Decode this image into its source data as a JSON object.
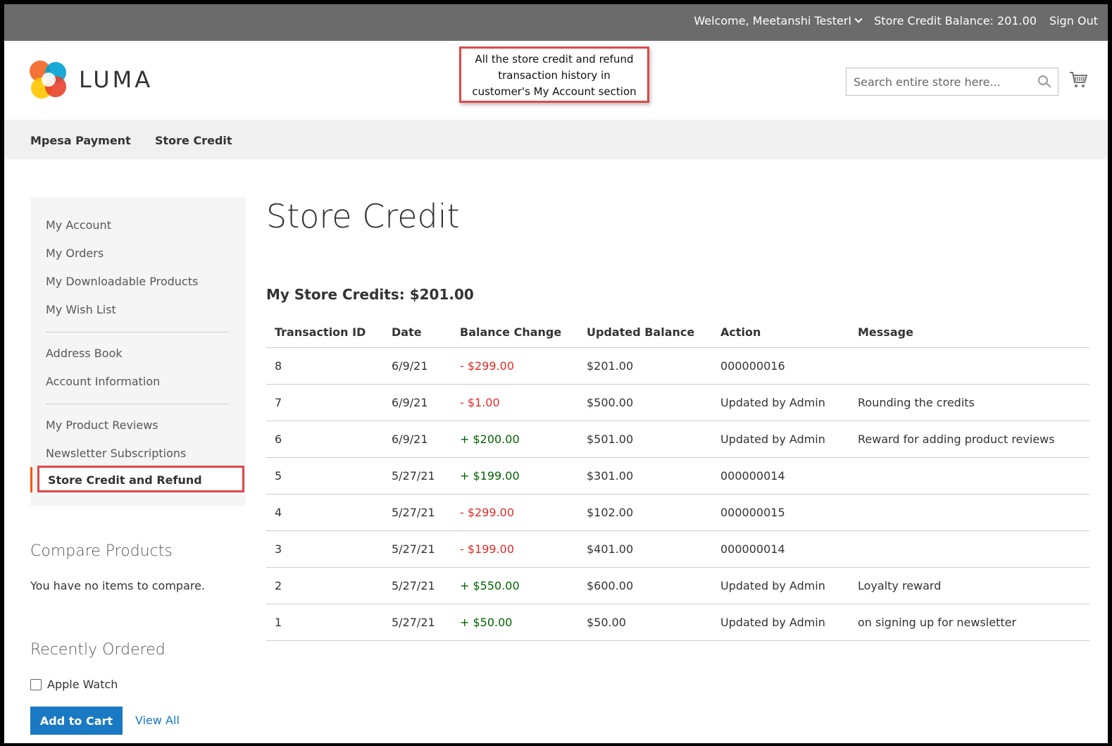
{
  "topbar": {
    "welcome": "Welcome, Meetanshi TesterI",
    "balance": "Store Credit Balance: 201.00",
    "sign_out": "Sign Out"
  },
  "header": {
    "logo_text": "LUMA",
    "search_placeholder": "Search entire store here...",
    "callout_lines": [
      "All the store credit and refund",
      "transaction history in",
      "customer's My Account section"
    ]
  },
  "nav": {
    "items": [
      "Mpesa Payment",
      "Store Credit"
    ]
  },
  "sidebar": {
    "items": [
      "My Account",
      "My Orders",
      "My Downloadable Products",
      "My Wish List",
      "Address Book",
      "Account Information",
      "My Product Reviews",
      "Newsletter Subscriptions"
    ],
    "active": "Store Credit and Refund"
  },
  "compare": {
    "title": "Compare Products",
    "empty": "You have no items to compare."
  },
  "recent": {
    "title": "Recently Ordered",
    "item": "Apple Watch",
    "add_to_cart": "Add to Cart",
    "view_all": "View All"
  },
  "main": {
    "page_title": "Store Credit",
    "credits_title": "My Store Credits: $201.00",
    "columns": [
      "Transaction ID",
      "Date",
      "Balance Change",
      "Updated Balance",
      "Action",
      "Message"
    ],
    "rows": [
      {
        "id": "8",
        "date": "6/9/21",
        "change": "- $299.00",
        "sign": "neg",
        "balance": "$201.00",
        "action": "000000016",
        "message": ""
      },
      {
        "id": "7",
        "date": "6/9/21",
        "change": "- $1.00",
        "sign": "neg",
        "balance": "$500.00",
        "action": "Updated by Admin",
        "message": "Rounding the credits"
      },
      {
        "id": "6",
        "date": "6/9/21",
        "change": "+ $200.00",
        "sign": "pos",
        "balance": "$501.00",
        "action": "Updated by Admin",
        "message": "Reward for adding product reviews"
      },
      {
        "id": "5",
        "date": "5/27/21",
        "change": "+ $199.00",
        "sign": "pos",
        "balance": "$301.00",
        "action": "000000014",
        "message": ""
      },
      {
        "id": "4",
        "date": "5/27/21",
        "change": "- $299.00",
        "sign": "neg",
        "balance": "$102.00",
        "action": "000000015",
        "message": ""
      },
      {
        "id": "3",
        "date": "5/27/21",
        "change": "- $199.00",
        "sign": "neg",
        "balance": "$401.00",
        "action": "000000014",
        "message": ""
      },
      {
        "id": "2",
        "date": "5/27/21",
        "change": "+ $550.00",
        "sign": "pos",
        "balance": "$600.00",
        "action": "Updated by Admin",
        "message": "Loyalty reward"
      },
      {
        "id": "1",
        "date": "5/27/21",
        "change": "+ $50.00",
        "sign": "pos",
        "balance": "$50.00",
        "action": "Updated by Admin",
        "message": "on signing up for newsletter"
      }
    ]
  },
  "colors": {
    "topbar": "#6b6b6b",
    "link": "#1979c3",
    "negative": "#e02b27",
    "positive": "#006400",
    "highlight": "#e04848"
  }
}
